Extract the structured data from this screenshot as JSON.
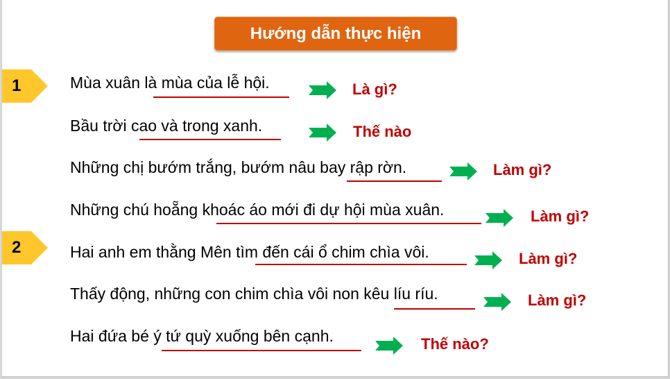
{
  "title": "Hướng dẫn thực hiện",
  "badges": [
    {
      "label": "1",
      "color": "#ffc72c"
    },
    {
      "label": "2",
      "color": "#ffc72c"
    }
  ],
  "rows": [
    {
      "sentence": "Mùa xuân là mùa của lễ hội.",
      "underlined_part": "là mùa của lễ hội",
      "answer": "Là gì?"
    },
    {
      "sentence": "Bầu trời cao và trong xanh.",
      "underlined_part": "cao và trong xanh",
      "answer": "Thế nào"
    },
    {
      "sentence": "Những chị bướm trắng, bướm nâu bay rập rờn.",
      "underlined_part": "bay rập rờn",
      "answer": "Làm gì?"
    },
    {
      "sentence": "Những chú hoẵng khoác áo mới đi dự hội mùa xuân.",
      "underlined_part": "khoác áo mới đi dự hội mùa xuân",
      "answer": "Làm gì?"
    },
    {
      "sentence": "Hai anh em thằng Mên tìm đến cái ổ chim chìa vôi.",
      "underlined_part": "tìm đến cái ổ chim chìa vôi",
      "answer": "Làm gì?"
    },
    {
      "sentence": "Thấy động, những con chim chìa vôi non kêu líu ríu.",
      "underlined_part": "kêu líu ríu",
      "answer": "Làm gì?"
    },
    {
      "sentence": "Hai đứa bé ý tứ quỳ xuống bên cạnh.",
      "underlined_part": "ý tứ quỳ xuống bên cạnh",
      "answer": "Thế nào?"
    }
  ],
  "colors": {
    "title_bg": "#df6510",
    "answer_text": "#c00000",
    "underline": "#c00000",
    "arrow": "#00b050",
    "badge": "#ffc72c"
  }
}
